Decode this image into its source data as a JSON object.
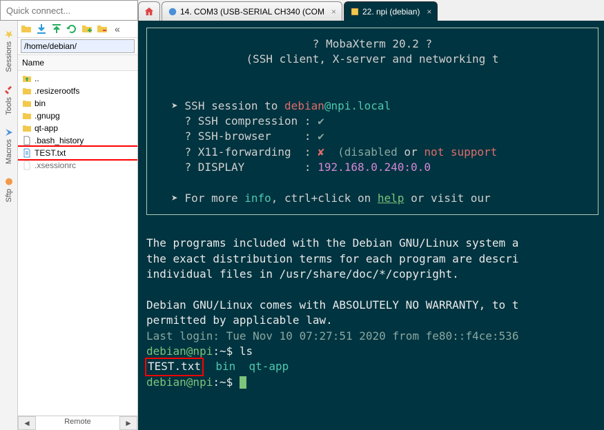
{
  "quick_connect_placeholder": "Quick connect...",
  "tabs": {
    "tab1_label": "14. COM3 (USB-SERIAL CH340 (COM",
    "tab2_label": "22. npi (debian)"
  },
  "vert": {
    "sessions": "Sessions",
    "tools": "Tools",
    "macros": "Macros",
    "sftp": "Sftp"
  },
  "path": "/home/debian/",
  "name_header": "Name",
  "files": [
    {
      "label": "..",
      "type": "up"
    },
    {
      "label": ".resizerootfs",
      "type": "folder"
    },
    {
      "label": "bin",
      "type": "folder"
    },
    {
      "label": ".gnupg",
      "type": "folder"
    },
    {
      "label": "qt-app",
      "type": "folder"
    },
    {
      "label": ".bash_history",
      "type": "file"
    },
    {
      "label": "TEST.txt",
      "type": "file",
      "highlight": true
    },
    {
      "label": ".xsessionrc",
      "type": "file-faded"
    }
  ],
  "bottom_label": "Remote",
  "terminal": {
    "header1": "? MobaXterm 20.2 ?",
    "header2": "(SSH client, X-server and networking t",
    "ssh_to_1": "SSH session to ",
    "ssh_user": "debian",
    "ssh_at": "@",
    "ssh_host": "npi.local",
    "compression": "? SSH compression : ",
    "browser": "? SSH-browser     : ",
    "x11": "? X11-forwarding  : ",
    "x11_dis": "(disabled",
    "x11_or": " or ",
    "x11_notsup": "not support",
    "display": "? DISPLAY         : ",
    "display_val": "192.168.0.240:0.0",
    "moreinfo1": "For more ",
    "moreinfo_info": "info",
    "moreinfo2": ", ctrl+click on ",
    "moreinfo_help": "help",
    "moreinfo3": " or visit our ",
    "body1": "The programs included with the Debian GNU/Linux system a",
    "body2": "the exact distribution terms for each program are descri",
    "body3": "individual files in /usr/share/doc/*/copyright.",
    "body4": "Debian GNU/Linux comes with ABSOLUTELY NO WARRANTY, to t",
    "body5": "permitted by applicable law.",
    "lastlogin_lbl": "Last login:",
    "lastlogin_val": " Tue Nov 10 07:27:51 2020 from fe80::f4ce:536",
    "prompt_user": "debian@npi",
    "prompt_path": ":~$ ",
    "cmd1": "ls",
    "ls_test": "TEST.txt",
    "ls_bin": "bin",
    "ls_qt": "qt-app",
    "check": "✔",
    "xmark": "✘",
    "arrow": "➤"
  }
}
